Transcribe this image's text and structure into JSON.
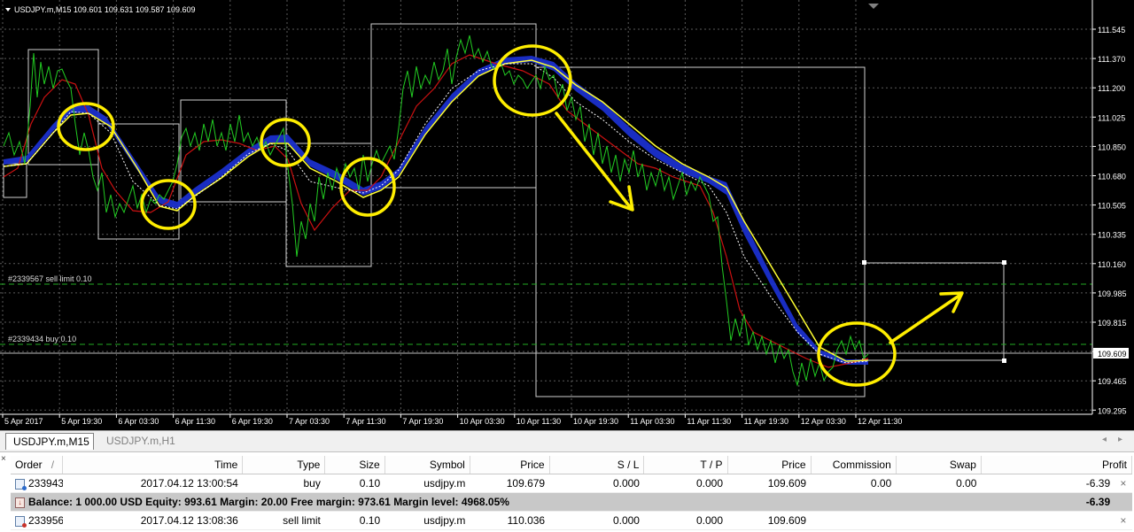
{
  "chart": {
    "header": "USDJPY.m,M15  109.601 109.631 109.587 109.609",
    "price_labels": [
      "111.545",
      "111.370",
      "111.200",
      "111.025",
      "110.850",
      "110.680",
      "110.505",
      "110.335",
      "110.160",
      "109.985",
      "109.815",
      "109.640",
      "109.465",
      "109.295"
    ],
    "current_price": "109.609",
    "time_labels": [
      "5 Apr 2017",
      "5 Apr 19:30",
      "6 Apr 03:30",
      "6 Apr 11:30",
      "6 Apr 19:30",
      "7 Apr 03:30",
      "7 Apr 11:30",
      "7 Apr 19:30",
      "10 Apr 03:30",
      "10 Apr 11:30",
      "10 Apr 19:30",
      "11 Apr 03:30",
      "11 Apr 11:30",
      "11 Apr 19:30",
      "12 Apr 03:30",
      "12 Apr 11:30"
    ],
    "order_lines": {
      "sell_limit": "#2339567 sell limit 0.10",
      "buy": "#2339434 buy 0.10"
    },
    "colors": {
      "background": "#000000",
      "price_line": "#22cc22",
      "fast_ma": "#cc1111",
      "slow_ma": "#ffff33",
      "band": "#1a2fcc",
      "annotation": "#ffee00",
      "order_line": "#22aa22"
    }
  },
  "tabs": [
    {
      "label": "USDJPY.m,M15",
      "active": true
    },
    {
      "label": "USDJPY.m,H1",
      "active": false
    }
  ],
  "tab_nav": {
    "left": "◂",
    "right": "▸"
  },
  "terminal": {
    "columns": [
      "Order",
      "/",
      "Time",
      "Type",
      "Size",
      "Symbol",
      "Price",
      "S / L",
      "T / P",
      "Price",
      "Commission",
      "Swap",
      "Profit"
    ],
    "rows": [
      {
        "order": "2339434",
        "time": "2017.04.12 13:00:54",
        "type": "buy",
        "size": "0.10",
        "symbol": "usdjpy.m",
        "price": "109.679",
        "sl": "0.000",
        "tp": "0.000",
        "cur_price": "109.609",
        "commission": "0.00",
        "swap": "0.00",
        "profit": "-6.39",
        "close": "×"
      },
      {
        "order": "2339567",
        "time": "2017.04.12 13:08:36",
        "type": "sell limit",
        "size": "0.10",
        "symbol": "usdjpy.m",
        "price": "110.036",
        "sl": "0.000",
        "tp": "0.000",
        "cur_price": "109.609",
        "commission": "",
        "swap": "",
        "profit": "",
        "close": "×"
      }
    ],
    "balance": {
      "text": "Balance: 1 000.00 USD  Equity: 993.61  Margin: 20.00  Free margin: 973.61  Margin level: 4968.05%",
      "profit": "-6.39"
    },
    "side_close": "×"
  }
}
